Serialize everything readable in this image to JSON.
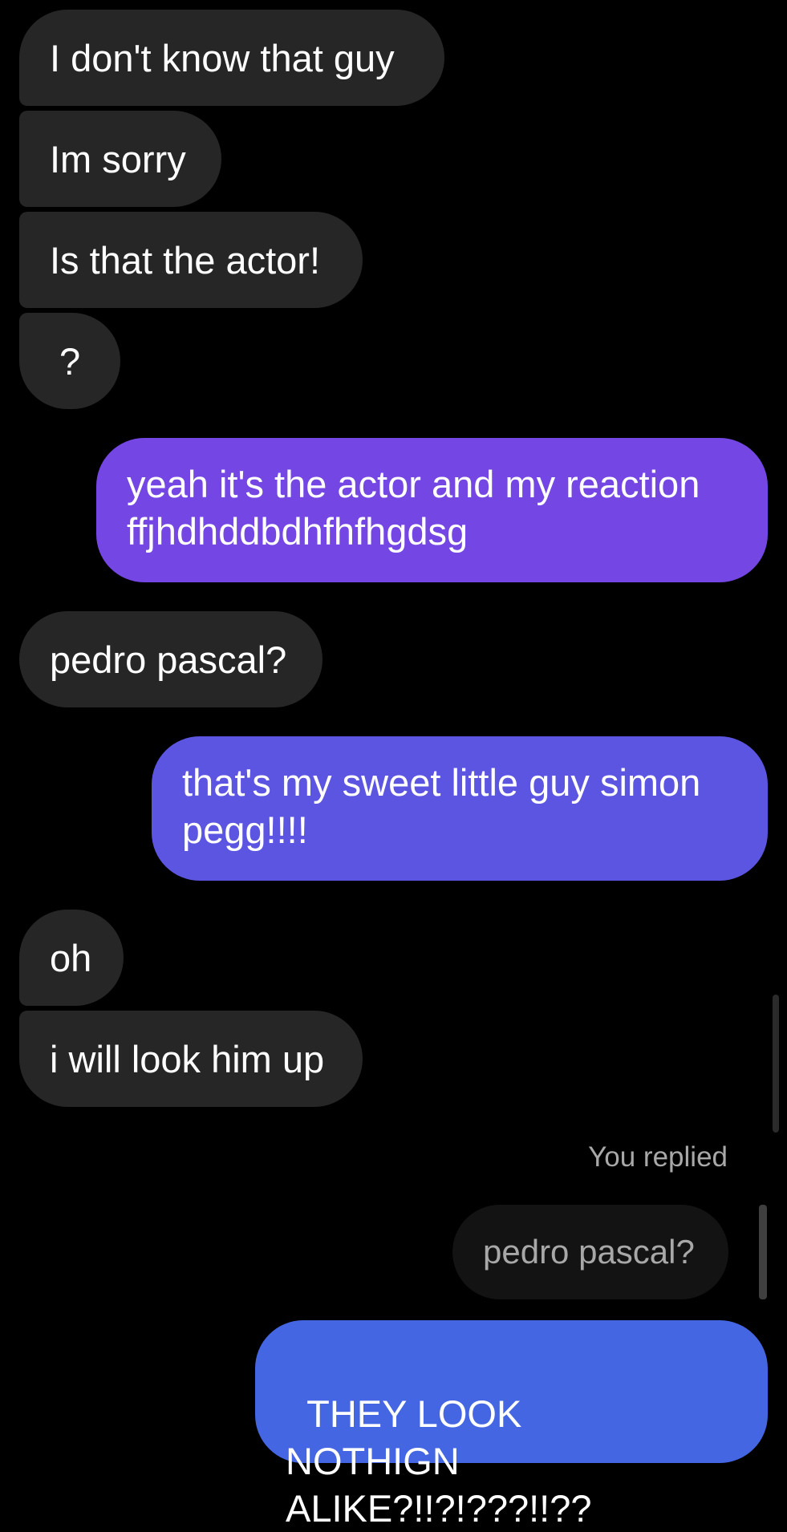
{
  "messages": [
    {
      "text": "I don't know that guy",
      "from": "them"
    },
    {
      "text": "Im sorry",
      "from": "them"
    },
    {
      "text": "Is that the actor!",
      "from": "them"
    },
    {
      "text": "?",
      "from": "them"
    },
    {
      "text": "yeah it's the actor and my reaction ffjhdhddbdhfhfhgdsg",
      "from": "me"
    },
    {
      "text": "pedro pascal?",
      "from": "them"
    },
    {
      "text": "that's my sweet little guy simon pegg!!!!",
      "from": "me"
    },
    {
      "text": "oh",
      "from": "them"
    },
    {
      "text": "i will look him up",
      "from": "them"
    },
    {
      "text": "THEY LOOK      NOTHIGN ALIKE?!!?!???!!??",
      "from": "me"
    }
  ],
  "reply": {
    "label": "You replied",
    "quoted_text": "pedro pascal?"
  },
  "colors": {
    "background": "#000000",
    "incoming_bubble": "#262626",
    "outgoing_gradient_top": "#7446e3",
    "outgoing_gradient_mid": "#5c55e2",
    "outgoing_gradient_bottom": "#4466e2",
    "muted_text": "#a8a8a8"
  }
}
